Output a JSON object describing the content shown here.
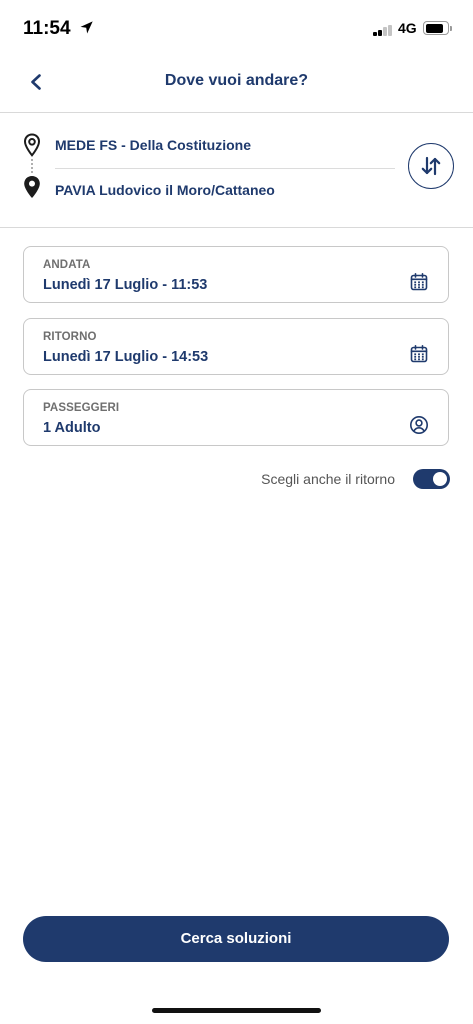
{
  "status_bar": {
    "time": "11:54",
    "network": "4G",
    "signal_bars": 2,
    "battery_level": 0.85,
    "icons": [
      "location-arrow-icon",
      "signal-strength-icon",
      "battery-icon"
    ]
  },
  "header": {
    "title": "Dove vuoi andare?",
    "back_icon": "chevron-left-icon"
  },
  "route": {
    "origin": "MEDE FS - Della Costituzione",
    "destination": "PAVIA Ludovico il Moro/Cattaneo",
    "origin_icon": "map-pin-outline-icon",
    "destination_icon": "map-pin-filled-icon",
    "swap_icon": "swap-vertical-icon"
  },
  "fields": [
    {
      "label": "ANDATA",
      "value": "Lunedì 17 Luglio - 11:53",
      "icon": "calendar-icon"
    },
    {
      "label": "RITORNO",
      "value": "Lunedì 17 Luglio - 14:53",
      "icon": "calendar-icon"
    },
    {
      "label": "PASSEGGERI",
      "value": "1 Adulto",
      "icon": "user-circle-icon"
    }
  ],
  "return_toggle": {
    "label": "Scegli anche il ritorno",
    "on": true
  },
  "search_button": {
    "label": "Cerca soluzioni"
  },
  "colors": {
    "primary": "#1f3a6d",
    "pin": "#1c1c1c",
    "label": "#6f6f6f",
    "muted": "#555555",
    "border": "#c8c8c8",
    "divider": "#d9d9d9"
  }
}
